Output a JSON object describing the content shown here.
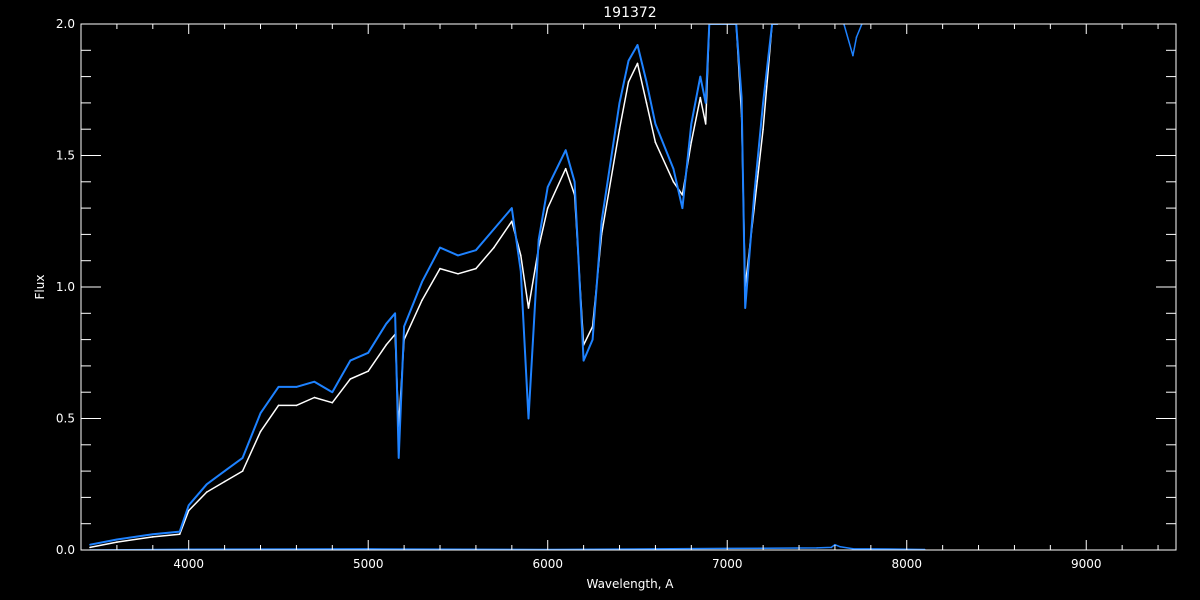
{
  "chart_data": {
    "type": "line",
    "title": "191372",
    "xlabel": "Wavelength, A",
    "ylabel": "Flux",
    "xlim": [
      3400,
      9500
    ],
    "ylim": [
      0,
      2.0
    ],
    "x_ticks": [
      4000,
      5000,
      6000,
      7000,
      8000,
      9000
    ],
    "y_ticks": [
      0.0,
      0.5,
      1.0,
      1.5,
      2.0
    ],
    "y_tick_labels": [
      "0.0",
      "0.5",
      "1.0",
      "1.5",
      "2.0"
    ],
    "grid": false,
    "colors": {
      "background": "#000000",
      "axes": "#ffffff",
      "model": "#ffffff",
      "observed": "#1e82ff"
    },
    "series": [
      {
        "color": "#ffffff",
        "x": [
          3450,
          3600,
          3800,
          3950,
          4000,
          4100,
          4200,
          4300,
          4400,
          4500,
          4600,
          4700,
          4800,
          4900,
          5000,
          5100,
          5150,
          5170,
          5200,
          5300,
          5400,
          5500,
          5600,
          5700,
          5800,
          5850,
          5893,
          5950,
          6000,
          6100,
          6150,
          6200,
          6250,
          6300,
          6400,
          6450,
          6500,
          6550,
          6600,
          6700,
          6750,
          6800,
          6850,
          6880,
          6900,
          6950,
          7000,
          7050,
          7080,
          7100,
          7150,
          7200,
          7250,
          7280
        ],
        "values": [
          0.01,
          0.03,
          0.05,
          0.06,
          0.15,
          0.22,
          0.26,
          0.3,
          0.45,
          0.55,
          0.55,
          0.58,
          0.56,
          0.65,
          0.68,
          0.78,
          0.82,
          0.47,
          0.8,
          0.95,
          1.07,
          1.05,
          1.07,
          1.15,
          1.25,
          1.12,
          0.92,
          1.15,
          1.3,
          1.45,
          1.35,
          0.78,
          0.85,
          1.2,
          1.6,
          1.78,
          1.85,
          1.7,
          1.55,
          1.4,
          1.35,
          1.55,
          1.72,
          1.62,
          2.0,
          2.0,
          2.0,
          2.0,
          1.65,
          1.0,
          1.3,
          1.6,
          2.0,
          2.0
        ]
      },
      {
        "color": "#1e82ff",
        "x": [
          3450,
          3600,
          3800,
          3950,
          4000,
          4100,
          4200,
          4300,
          4400,
          4500,
          4600,
          4700,
          4800,
          4900,
          5000,
          5100,
          5150,
          5170,
          5200,
          5300,
          5400,
          5500,
          5600,
          5700,
          5800,
          5850,
          5893,
          5950,
          6000,
          6100,
          6150,
          6200,
          6250,
          6300,
          6400,
          6450,
          6500,
          6550,
          6600,
          6700,
          6750,
          6800,
          6850,
          6880,
          6900,
          6950,
          7000,
          7050,
          7080,
          7100,
          7150,
          7200,
          7250,
          7280
        ],
        "values": [
          0.02,
          0.04,
          0.06,
          0.07,
          0.17,
          0.25,
          0.3,
          0.35,
          0.52,
          0.62,
          0.62,
          0.64,
          0.6,
          0.72,
          0.75,
          0.86,
          0.9,
          0.35,
          0.85,
          1.02,
          1.15,
          1.12,
          1.14,
          1.22,
          1.3,
          1.06,
          0.5,
          1.18,
          1.38,
          1.52,
          1.4,
          0.72,
          0.8,
          1.25,
          1.7,
          1.86,
          1.92,
          1.78,
          1.62,
          1.45,
          1.3,
          1.62,
          1.8,
          1.7,
          2.0,
          2.0,
          2.0,
          2.0,
          1.72,
          0.92,
          1.35,
          1.7,
          2.0,
          2.0
        ]
      },
      {
        "color": "#1e82ff",
        "x": [
          3450,
          4000,
          5000,
          6000,
          7000,
          7500,
          7580,
          7600,
          7630,
          7700,
          8000,
          8100
        ],
        "values": [
          0.0,
          0.003,
          0.004,
          0.002,
          0.006,
          0.008,
          0.01,
          0.02,
          0.012,
          0.005,
          0.003,
          0.002
        ]
      },
      {
        "color": "#1e82ff",
        "x": [
          7650,
          7700,
          7720,
          7750
        ],
        "values": [
          2.0,
          1.88,
          1.95,
          2.0
        ]
      }
    ]
  }
}
